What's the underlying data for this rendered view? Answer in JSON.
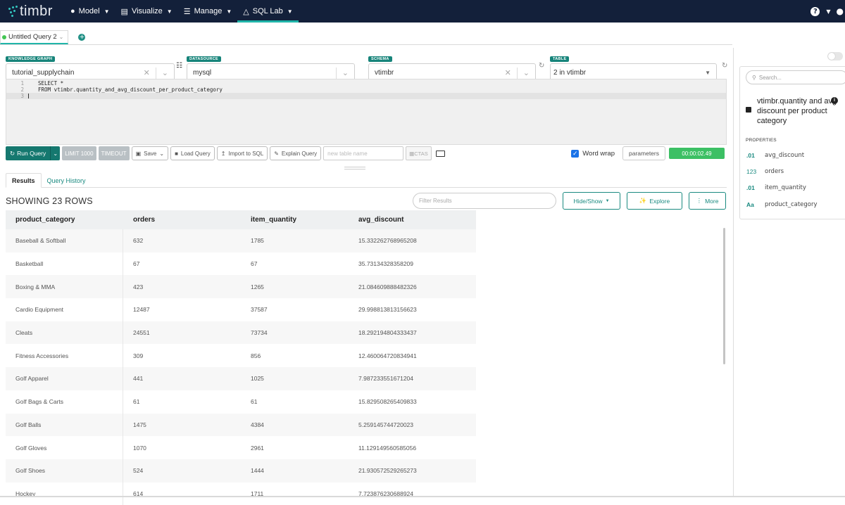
{
  "nav": {
    "logo": "timbr",
    "items": [
      {
        "label": "Model",
        "icon": "bulb-icon"
      },
      {
        "label": "Visualize",
        "icon": "chart-icon"
      },
      {
        "label": "Manage",
        "icon": "database-icon"
      },
      {
        "label": "SQL Lab",
        "icon": "flask-icon"
      }
    ]
  },
  "query_tab": {
    "label": "Untitled Query 2"
  },
  "selectors": {
    "knowledge_graph": {
      "label": "KNOWLEDGE GRAPH",
      "value": "tutorial_supplychain"
    },
    "datasource": {
      "label": "DATASOURCE",
      "value": "mysql"
    },
    "schema": {
      "label": "SCHEMA",
      "value": "vtimbr"
    },
    "table": {
      "label": "TABLE",
      "value": "2 in vtimbr"
    }
  },
  "editor": {
    "lines": [
      {
        "num": "1",
        "text": "SELECT *"
      },
      {
        "num": "2",
        "text": "FROM vtimbr.quantity_and_avg_discount_per_product_category"
      },
      {
        "num": "3",
        "text": ""
      }
    ]
  },
  "toolbar": {
    "run": "Run Query",
    "limit": "LIMIT 1000",
    "timeout": "TIMEOUT",
    "save": "Save",
    "load": "Load Query",
    "import": "Import to SQL",
    "explain": "Explain Query",
    "table_name_placeholder": "new table name",
    "ctas": "CTAS",
    "word_wrap": "Word wrap",
    "parameters": "parameters",
    "timer": "00:00:02.49"
  },
  "result_tabs": {
    "results": "Results",
    "history": "Query History"
  },
  "results": {
    "showing": "SHOWING 23 ROWS",
    "filter_placeholder": "Filter Results",
    "hide_show": "Hide/Show",
    "explore": "Explore",
    "more": "More",
    "columns": [
      "product_category",
      "orders",
      "item_quantity",
      "avg_discount"
    ],
    "rows": [
      [
        "Baseball & Softball",
        "632",
        "1785",
        "15.332262768965208"
      ],
      [
        "Basketball",
        "67",
        "67",
        "35.73134328358209"
      ],
      [
        "Boxing & MMA",
        "423",
        "1265",
        "21.084609888482326"
      ],
      [
        "Cardio Equipment",
        "12487",
        "37587",
        "29.998813813156623"
      ],
      [
        "Cleats",
        "24551",
        "73734",
        "18.292194804333437"
      ],
      [
        "Fitness Accessories",
        "309",
        "856",
        "12.460064720834941"
      ],
      [
        "Golf Apparel",
        "441",
        "1025",
        "7.987233551671204"
      ],
      [
        "Golf Bags & Carts",
        "61",
        "61",
        "15.829508265409833"
      ],
      [
        "Golf Balls",
        "1475",
        "4384",
        "5.259145744720023"
      ],
      [
        "Golf Gloves",
        "1070",
        "2961",
        "11.129149560585056"
      ],
      [
        "Golf Shoes",
        "524",
        "1444",
        "21.930572529265273"
      ],
      [
        "Hockey",
        "614",
        "1711",
        "7.723876230688924"
      ]
    ]
  },
  "panel": {
    "search_placeholder": "Search...",
    "title": "vtimbr.quantity and avg discount per product category",
    "properties_label": "PROPERTIES",
    "properties": [
      {
        "type": ".01",
        "name": "avg_discount"
      },
      {
        "type": "123",
        "name": "orders"
      },
      {
        "type": ".01",
        "name": "item_quantity"
      },
      {
        "type": "Aa",
        "name": "product_category"
      }
    ]
  }
}
